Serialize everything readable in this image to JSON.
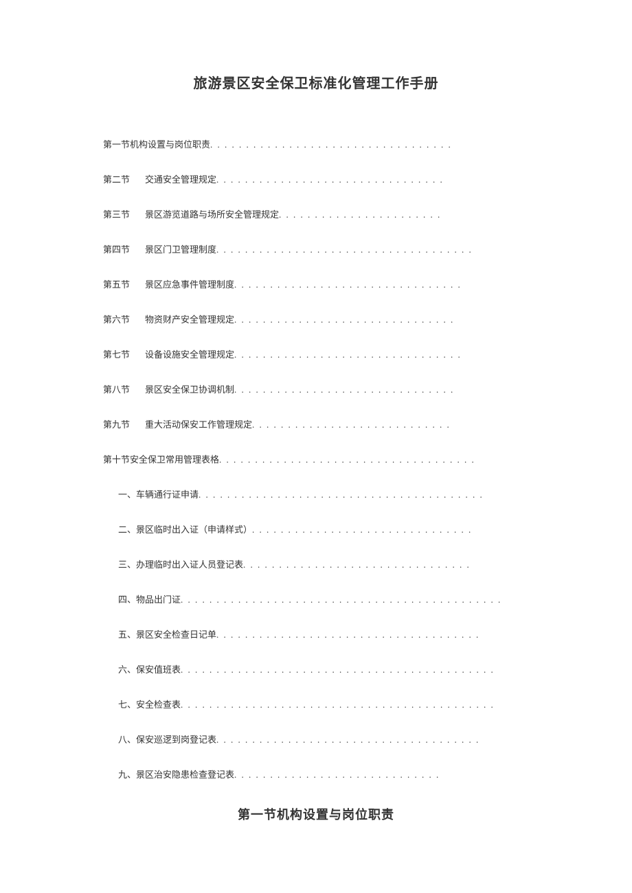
{
  "title": "旅游景区安全保卫标准化管理工作手册",
  "toc": [
    {
      "label": "第一节机构设置与岗位职责",
      "text": "",
      "gap": false,
      "indent": 0,
      "dots": ". . . . . . . . . . . . . . . . . . . . . . . . . . . . . . . . . ."
    },
    {
      "label": "第二节",
      "text": "交通安全管理规定",
      "gap": true,
      "indent": 0,
      "dots": ". . . . . . . . . . . . . . . . . . . . . . . . . . . . . . . ."
    },
    {
      "label": "第三节",
      "text": "景区游览道路与场所安全管理规定",
      "gap": true,
      "indent": 0,
      "dots": " . . . . . . . . . . . . . . . . . . . . . . ."
    },
    {
      "label": "第四节",
      "text": "景区门卫管理制度",
      "gap": true,
      "indent": 0,
      "dots": ". . . . . . . . . . . . . . . . . . . . . . . . . . . . . . . . . . . ."
    },
    {
      "label": "第五节",
      "text": "景区应急事件管理制度",
      "gap": true,
      "indent": 0,
      "dots": ". . . . . . . . . . . . . . . . . . . . . . . . . . . . . . . ."
    },
    {
      "label": "第六节",
      "text": "物资财产安全管理规定",
      "gap": true,
      "indent": 0,
      "dots": ". . . . . . . . . . . . . . . . . . . . . . . . . . . . . . ."
    },
    {
      "label": "第七节",
      "text": "设备设施安全管理规定",
      "gap": true,
      "indent": 0,
      "dots": ". . . . . . . . . . . . . . . . . . . . . . . . . . . . . . . ."
    },
    {
      "label": "第八节",
      "text": "景区安全保卫协调机制",
      "gap": true,
      "indent": 0,
      "dots": " . . . . . . . . . . . . . . . . . . . . . . . . . . . . . . ."
    },
    {
      "label": "第九节",
      "text": "重大活动保安工作管理规定",
      "gap": true,
      "indent": 0,
      "dots": ". . . . . . . . . . . . . . . . . . . . . . . . . . . ."
    },
    {
      "label": "第十节安全保卫常用管理表格",
      "text": "",
      "gap": false,
      "indent": 0,
      "dots": ". . . . . . . . . . . . . . . . . . . . . . . . . . . . . . . . . . . ."
    },
    {
      "label": "一、车辆通行证申请",
      "text": "",
      "gap": false,
      "indent": 1,
      "dots": ". . . . . . . . . . . . . . . . . . . . . . . . . . . . . . . . . . . . . . . ."
    },
    {
      "label": "二、景区临时出入证（申请样式）",
      "text": "",
      "gap": false,
      "indent": 1,
      "dots": " . . . . . . . . . . . . . . . . . . . . . . . . . . . . . . ."
    },
    {
      "label": "三、办理临时出入证人员登记表",
      "text": "",
      "gap": false,
      "indent": 1,
      "dots": " . . . . . . . . . . . . . . . . . . . . . . . . . . . . . . . ."
    },
    {
      "label": "四、物品出门证",
      "text": "",
      "gap": false,
      "indent": 1,
      "dots": ". . . . . . . . . . . . . . . . . . . . . . . . . . . . . . . . . . . . . . . . . . . . ."
    },
    {
      "label": "五、景区安全检查日记单",
      "text": "",
      "gap": false,
      "indent": 1,
      "dots": ". . . . . . . . . . . . . . . . . . . . . . . . . . . . . . . . . . . . ."
    },
    {
      "label": "六、保安值班表",
      "text": "",
      "gap": false,
      "indent": 1,
      "dots": ". . . . . . . . . . . . . . . . . . . . . . . . . . . . . . . . . . . . . . . . . . . ."
    },
    {
      "label": "七、安全检查表",
      "text": "",
      "gap": false,
      "indent": 1,
      "dots": ". . . . . . . . . . . . . . . . . . . . . . . . . . . . . . . . . . . . . . . . . . . ."
    },
    {
      "label": "八、保安巡逻到岗登记表",
      "text": "",
      "gap": false,
      "indent": 1,
      "dots": ". . . . . . . . . . . . . . . . . . . . . . . . . . . . . . . . . . . . ."
    },
    {
      "label": "九、景区治安隐患检查登记表",
      "text": "",
      "gap": false,
      "indent": 1,
      "dots": " . . . . . . . . . . . . . . . . . . . . . . . . . . . . ."
    }
  ],
  "section_heading": "第一节机构设置与岗位职责"
}
